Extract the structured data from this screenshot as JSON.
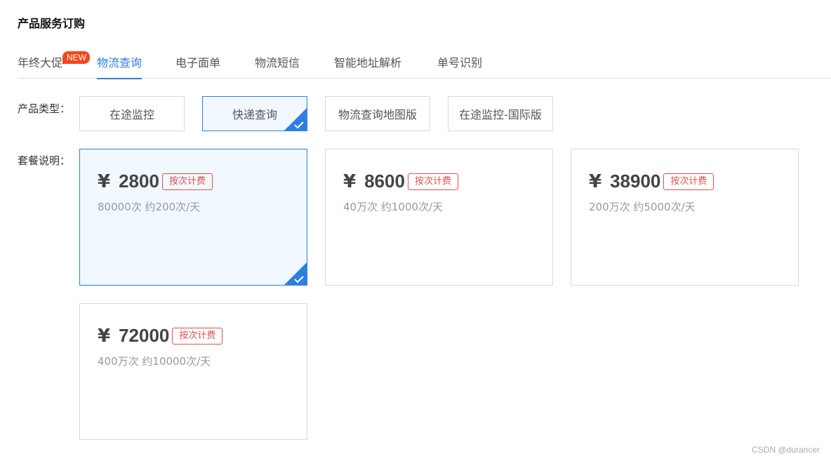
{
  "page": {
    "title": "产品服务订购"
  },
  "tabs": [
    {
      "label": "年终大促",
      "badge": "NEW",
      "active": false
    },
    {
      "label": "物流查询",
      "active": true
    },
    {
      "label": "电子面单",
      "active": false
    },
    {
      "label": "物流短信",
      "active": false
    },
    {
      "label": "智能地址解析",
      "active": false
    },
    {
      "label": "单号识别",
      "active": false
    }
  ],
  "product_type": {
    "label": "产品类型：",
    "options": [
      {
        "label": "在途监控",
        "selected": false
      },
      {
        "label": "快递查询",
        "selected": true
      },
      {
        "label": "物流查询地图版",
        "selected": false
      },
      {
        "label": "在途监控-国际版",
        "selected": false
      }
    ]
  },
  "plans": {
    "label": "套餐说明：",
    "currency_symbol": "¥",
    "items": [
      {
        "price": "2800",
        "tag": "按次计费",
        "quota": "80000次  约200次/天",
        "selected": true
      },
      {
        "price": "8600",
        "tag": "按次计费",
        "quota": "40万次  约1000次/天",
        "selected": false
      },
      {
        "price": "38900",
        "tag": "按次计费",
        "quota": "200万次  约5000次/天",
        "selected": false
      },
      {
        "price": "72000",
        "tag": "按次计费",
        "quota": "400万次  约10000次/天",
        "selected": false
      }
    ]
  },
  "watermark": "CSDN @durancer",
  "colors": {
    "accent": "#2f7fe0",
    "badge": "#f2481b",
    "tag": "#d9534f",
    "selected_bg": "#f1f8ff"
  }
}
